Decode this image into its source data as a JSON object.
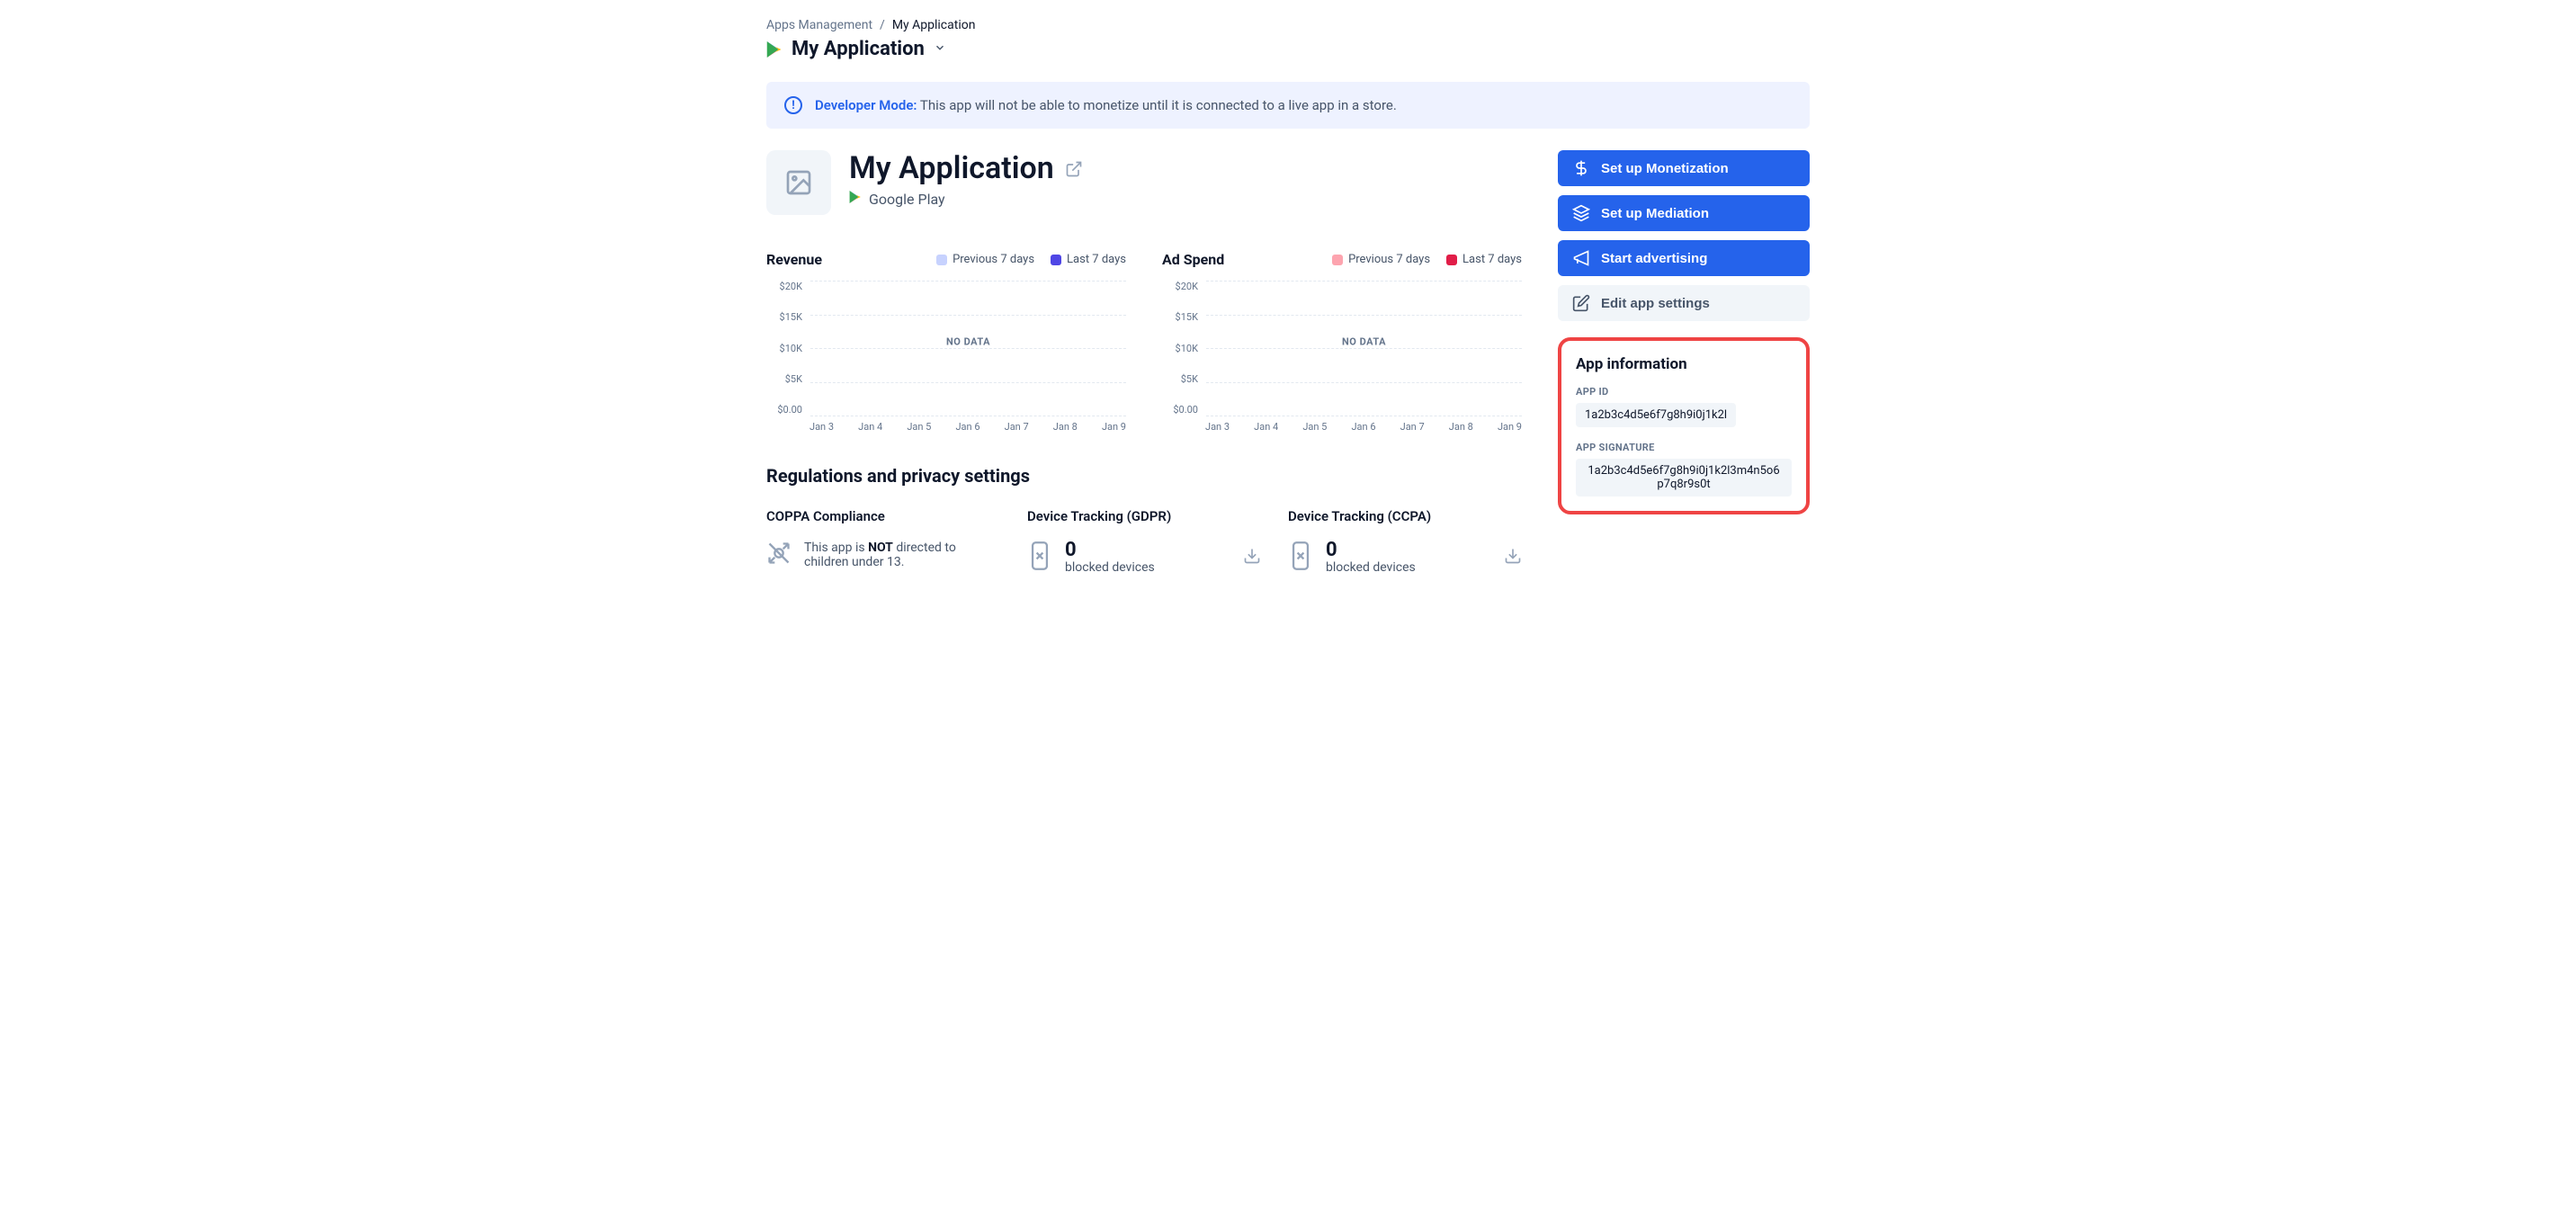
{
  "breadcrumb": {
    "parent": "Apps Management",
    "current": "My Application"
  },
  "titlebar": {
    "app_name": "My Application"
  },
  "alert": {
    "prefix": "Developer Mode:",
    "message": "This app will not be able to monetize until it is connected to a live app in a store."
  },
  "app_header": {
    "name": "My Application",
    "platform": "Google Play"
  },
  "charts": {
    "revenue": {
      "title": "Revenue",
      "legend_prev": "Previous 7 days",
      "legend_curr": "Last 7 days",
      "no_data": "NO DATA",
      "swatch_prev": "#c7d2fe",
      "swatch_curr": "#4f46e5"
    },
    "adspend": {
      "title": "Ad Spend",
      "legend_prev": "Previous 7 days",
      "legend_curr": "Last 7 days",
      "no_data": "NO DATA",
      "swatch_prev": "#fda4af",
      "swatch_curr": "#e11d48"
    },
    "yticks": [
      "$20K",
      "$15K",
      "$10K",
      "$5K",
      "$0.00"
    ],
    "xticks": [
      "Jan 3",
      "Jan 4",
      "Jan 5",
      "Jan 6",
      "Jan 7",
      "Jan 8",
      "Jan 9"
    ]
  },
  "regulations": {
    "heading": "Regulations and privacy settings",
    "coppa": {
      "title": "COPPA Compliance",
      "text_pre": "This app is ",
      "text_bold": "NOT",
      "text_post": " directed to children under 13."
    },
    "gdpr": {
      "title": "Device Tracking (GDPR)",
      "count": "0",
      "label": "blocked devices"
    },
    "ccpa": {
      "title": "Device Tracking (CCPA)",
      "count": "0",
      "label": "blocked devices"
    }
  },
  "sidebar": {
    "monetization": "Set up Monetization",
    "mediation": "Set up Mediation",
    "advertising": "Start advertising",
    "edit_settings": "Edit app settings"
  },
  "app_info": {
    "heading": "App information",
    "id_label": "APP ID",
    "id_value": "1a2b3c4d5e6f7g8h9i0j1k2l",
    "sig_label": "APP SIGNATURE",
    "sig_value": "1a2b3c4d5e6f7g8h9i0j1k2l3m4n5o6p7q8r9s0t"
  },
  "chart_data": [
    {
      "type": "line",
      "title": "Revenue",
      "categories": [
        "Jan 3",
        "Jan 4",
        "Jan 5",
        "Jan 6",
        "Jan 7",
        "Jan 8",
        "Jan 9"
      ],
      "series": [
        {
          "name": "Previous 7 days",
          "values": []
        },
        {
          "name": "Last 7 days",
          "values": []
        }
      ],
      "ylabel": "",
      "ylim": [
        0,
        20000
      ],
      "yticks": [
        0,
        5000,
        10000,
        15000,
        20000
      ],
      "no_data": true
    },
    {
      "type": "line",
      "title": "Ad Spend",
      "categories": [
        "Jan 3",
        "Jan 4",
        "Jan 5",
        "Jan 6",
        "Jan 7",
        "Jan 8",
        "Jan 9"
      ],
      "series": [
        {
          "name": "Previous 7 days",
          "values": []
        },
        {
          "name": "Last 7 days",
          "values": []
        }
      ],
      "ylabel": "",
      "ylim": [
        0,
        20000
      ],
      "yticks": [
        0,
        5000,
        10000,
        15000,
        20000
      ],
      "no_data": true
    }
  ]
}
